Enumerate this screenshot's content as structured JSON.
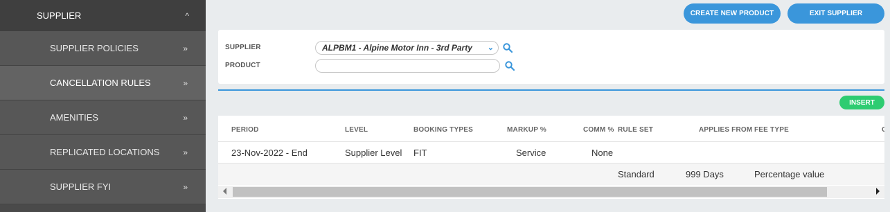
{
  "sidebar": {
    "header": {
      "label": "SUPPLIER",
      "icon": "chevron-up-icon",
      "chevron": "^"
    },
    "items": [
      {
        "label": "SUPPLIER POLICIES",
        "chevron": "»"
      },
      {
        "label": "CANCELLATION RULES",
        "chevron": "»",
        "active": true
      },
      {
        "label": "AMENITIES",
        "chevron": "»"
      },
      {
        "label": "REPLICATED LOCATIONS",
        "chevron": "»"
      },
      {
        "label": "SUPPLIER FYI",
        "chevron": "»"
      }
    ]
  },
  "toolbar": {
    "create_label": "CREATE NEW PRODUCT",
    "exit_label": "EXIT SUPPLIER",
    "insert_label": "INSERT"
  },
  "filter": {
    "supplier_label": "SUPPLIER",
    "supplier_value": "ALPBM1 - Alpine Motor Inn - 3rd Party",
    "product_label": "PRODUCT",
    "product_value": ""
  },
  "table": {
    "headers": {
      "period": "PERIOD",
      "level": "LEVEL",
      "booking_types": "BOOKING TYPES",
      "markup": "MARKUP %",
      "comm": "COMM %",
      "rule_set": "RULE SET",
      "applies_from": "APPLIES FROM",
      "fee_type": "FEE TYPE",
      "cut": "C"
    },
    "row1": {
      "period": "23-Nov-2022 - End",
      "level": "Supplier Level",
      "booking_types": "FIT",
      "markup": "Service",
      "comm": "None"
    },
    "row2": {
      "rule_set": "Standard",
      "applies_from": "999 Days",
      "fee_type": "Percentage value"
    }
  },
  "colors": {
    "accent": "#3a96db",
    "insert": "#2ecc71",
    "sidebar": "#4a4a4a"
  }
}
